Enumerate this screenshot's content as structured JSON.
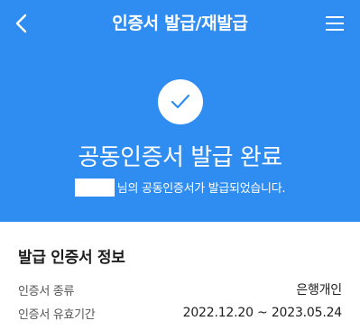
{
  "header": {
    "title": "인증서 발급/재발급",
    "back_icon": "chevron-left-icon",
    "menu_icon": "hamburger-menu-icon"
  },
  "result": {
    "icon": "check-icon",
    "title": "공동인증서 발급 완료",
    "message": "님의 공동인증서가 발급되었습니다."
  },
  "info": {
    "section_title": "발급 인증서 정보",
    "rows": [
      {
        "label": "인증서 종류",
        "value": "은행개인"
      },
      {
        "label": "인증서 유효기간",
        "value": "2022.12.20 ~ 2023.05.24"
      }
    ]
  },
  "colors": {
    "primary": "#2f8cf0",
    "background": "#ffffff",
    "text": "#1d1d1d"
  }
}
